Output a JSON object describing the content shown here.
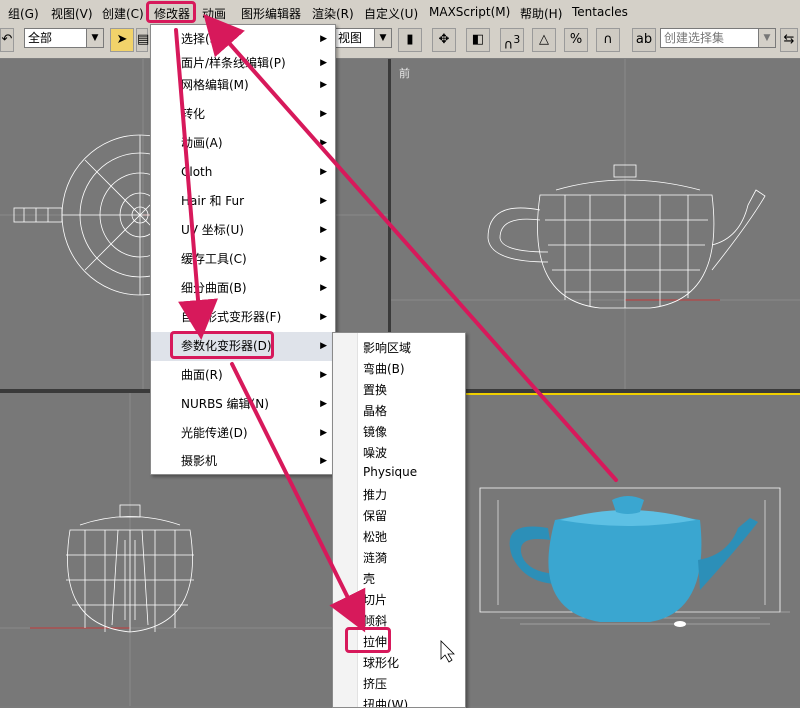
{
  "menubar": {
    "items": [
      "组(G)",
      "视图(V)",
      "创建(C)",
      "修改器",
      "动画",
      "图形编辑器",
      "渲染(R)",
      "自定义(U)",
      "MAXScript(M)",
      "帮助(H)",
      "Tentacles"
    ]
  },
  "toolbar": {
    "filter_combo": "全部",
    "view_combo": "视图",
    "selection_set_placeholder": "创建选择集",
    "snap_label": "3"
  },
  "viewports": {
    "top_label": "",
    "front_label": "前",
    "left_label": "",
    "perspective_label": ""
  },
  "modifier_menu": {
    "items": [
      {
        "label": "选择(S)",
        "has_sub": true
      },
      {
        "label": "面片/样条线编辑(P)",
        "has_sub": true
      },
      {
        "label": "网格编辑(M)",
        "has_sub": true
      },
      {
        "label": "转化",
        "has_sub": true
      },
      {
        "label": "动画(A)",
        "has_sub": true
      },
      {
        "label": "Cloth",
        "has_sub": true
      },
      {
        "label": "Hair 和 Fur",
        "has_sub": true
      },
      {
        "label": "UV 坐标(U)",
        "has_sub": true
      },
      {
        "label": "缓存工具(C)",
        "has_sub": true
      },
      {
        "label": "细分曲面(B)",
        "has_sub": true
      },
      {
        "label": "自由形式变形器(F)",
        "has_sub": true
      },
      {
        "label": "参数化变形器(D)",
        "has_sub": true,
        "highlighted": true
      },
      {
        "label": "曲面(R)",
        "has_sub": true
      },
      {
        "label": "NURBS 编辑(N)",
        "has_sub": true
      },
      {
        "label": "光能传递(D)",
        "has_sub": true
      },
      {
        "label": "摄影机",
        "has_sub": true
      }
    ]
  },
  "param_submenu": {
    "items": [
      "影响区域",
      "弯曲(B)",
      "置换",
      "晶格",
      "镜像",
      "噪波",
      "Physique",
      "推力",
      "保留",
      "松弛",
      "涟漪",
      "壳",
      "切片",
      "倾斜",
      "拉伸",
      "球形化",
      "挤压",
      "扭曲(W)"
    ],
    "highlighted_index": 14
  },
  "colors": {
    "annotation": "#d7195b",
    "teapot": "#3aa6d0",
    "wire": "#ffffff",
    "ui_gray": "#d4d0c8"
  }
}
